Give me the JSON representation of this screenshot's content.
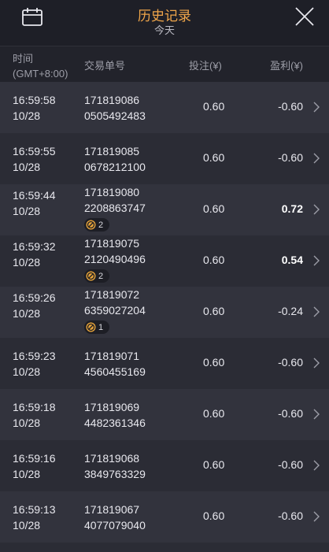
{
  "header": {
    "title": "历史记录",
    "subtitle": "今天"
  },
  "columns": {
    "time": "时间",
    "timezone": "(GMT+8:00)",
    "trade_id": "交易单号",
    "bet": "投注(¥)",
    "profit": "盈利(¥)"
  },
  "rows": [
    {
      "time": "16:59:58",
      "date": "10/28",
      "id1": "171819086",
      "id2": "0505492483",
      "bet": "0.60",
      "profit": "-0.60",
      "badge": null
    },
    {
      "time": "16:59:55",
      "date": "10/28",
      "id1": "171819085",
      "id2": "0678212100",
      "bet": "0.60",
      "profit": "-0.60",
      "badge": null
    },
    {
      "time": "16:59:44",
      "date": "10/28",
      "id1": "171819080",
      "id2": "2208863747",
      "bet": "0.60",
      "profit": "0.72",
      "badge": "2"
    },
    {
      "time": "16:59:32",
      "date": "10/28",
      "id1": "171819075",
      "id2": "2120490496",
      "bet": "0.60",
      "profit": "0.54",
      "badge": "2"
    },
    {
      "time": "16:59:26",
      "date": "10/28",
      "id1": "171819072",
      "id2": "6359027204",
      "bet": "0.60",
      "profit": "-0.24",
      "badge": "1"
    },
    {
      "time": "16:59:23",
      "date": "10/28",
      "id1": "171819071",
      "id2": "4560455169",
      "bet": "0.60",
      "profit": "-0.60",
      "badge": null
    },
    {
      "time": "16:59:18",
      "date": "10/28",
      "id1": "171819069",
      "id2": "4482361346",
      "bet": "0.60",
      "profit": "-0.60",
      "badge": null
    },
    {
      "time": "16:59:16",
      "date": "10/28",
      "id1": "171819068",
      "id2": "3849763329",
      "bet": "0.60",
      "profit": "-0.60",
      "badge": null
    },
    {
      "time": "16:59:13",
      "date": "10/28",
      "id1": "171819067",
      "id2": "4077079040",
      "bet": "0.60",
      "profit": "-0.60",
      "badge": null
    }
  ],
  "colors": {
    "accent": "#f0a64a",
    "background": "#2b2c35",
    "row_alt": "#32333d"
  }
}
